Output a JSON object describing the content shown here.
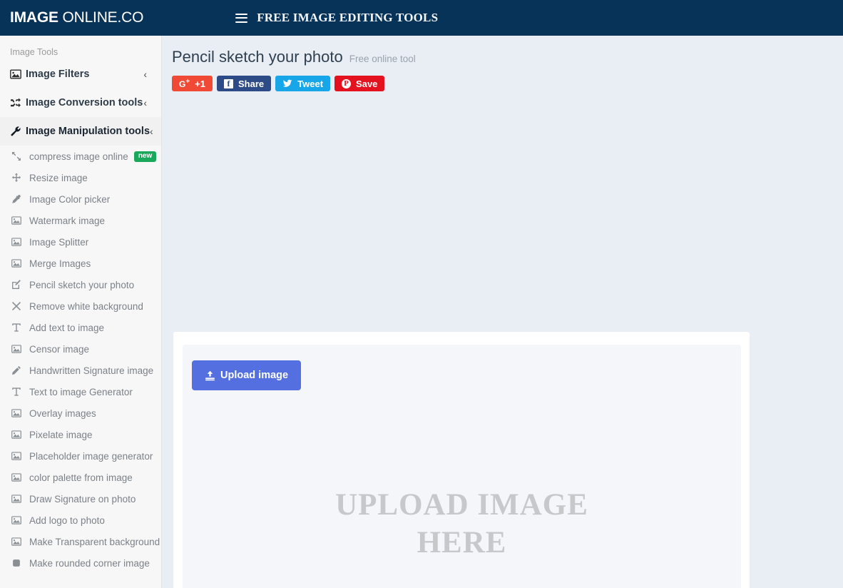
{
  "topnav": {
    "logo_strong": "IMAGE",
    "logo_light": " ONLINE.CO",
    "menu_icon": "hamburger-icon",
    "title": "FREE IMAGE EDITING TOOLS"
  },
  "sidebar": {
    "heading": "Image Tools",
    "groups": [
      {
        "label": "Image Filters",
        "icon": "image-icon",
        "chevron": "‹",
        "active": false
      },
      {
        "label": "Image Conversion tools",
        "icon": "shuffle-icon",
        "chevron": "‹",
        "active": false
      },
      {
        "label": "Image Manipulation tools",
        "icon": "wrench-icon",
        "chevron": "‹",
        "active": true
      }
    ],
    "tools": [
      {
        "label": "compress image online",
        "icon": "compress-icon",
        "badge": "new"
      },
      {
        "label": "Resize image",
        "icon": "arrows-move-icon",
        "badge": ""
      },
      {
        "label": "Image Color picker",
        "icon": "eyedropper-icon",
        "badge": ""
      },
      {
        "label": "Watermark image",
        "icon": "image-icon",
        "badge": ""
      },
      {
        "label": "Image Splitter",
        "icon": "image-icon",
        "badge": ""
      },
      {
        "label": "Merge Images",
        "icon": "image-icon",
        "badge": ""
      },
      {
        "label": "Pencil sketch your photo",
        "icon": "pencil-square-icon",
        "badge": ""
      },
      {
        "label": "Remove white background",
        "icon": "close-x-icon",
        "badge": ""
      },
      {
        "label": "Add text to image",
        "icon": "text-t-icon",
        "badge": ""
      },
      {
        "label": "Censor image",
        "icon": "image-icon",
        "badge": ""
      },
      {
        "label": "Handwritten Signature image",
        "icon": "pencil-icon",
        "badge": ""
      },
      {
        "label": "Text to image Generator",
        "icon": "text-t-icon",
        "badge": ""
      },
      {
        "label": "Overlay images",
        "icon": "image-icon",
        "badge": ""
      },
      {
        "label": "Pixelate image",
        "icon": "image-icon",
        "badge": ""
      },
      {
        "label": "Placeholder image generator",
        "icon": "image-icon",
        "badge": ""
      },
      {
        "label": "color palette from image",
        "icon": "image-icon",
        "badge": ""
      },
      {
        "label": "Draw Signature on photo",
        "icon": "image-icon",
        "badge": ""
      },
      {
        "label": "Add logo to photo",
        "icon": "image-icon",
        "badge": ""
      },
      {
        "label": "Make Transparent background",
        "icon": "image-icon",
        "badge": ""
      },
      {
        "label": "Make rounded corner image",
        "icon": "rounded-square-icon",
        "badge": ""
      }
    ]
  },
  "main": {
    "page_title": "Pencil sketch your photo",
    "page_subtitle": "Free online tool",
    "share_buttons": [
      {
        "label": "+1",
        "icon": "google-plus-icon",
        "color": "#f04a36"
      },
      {
        "label": "Share",
        "icon": "facebook-icon",
        "color": "#2d4b86"
      },
      {
        "label": "Tweet",
        "icon": "twitter-icon",
        "color": "#17a7e8"
      },
      {
        "label": "Save",
        "icon": "pinterest-icon",
        "color": "#e4121e"
      }
    ],
    "upload_button": "Upload image",
    "upload_icon": "upload-icon",
    "dropzone_line1": "UPLOAD IMAGE",
    "dropzone_line2": "HERE"
  }
}
